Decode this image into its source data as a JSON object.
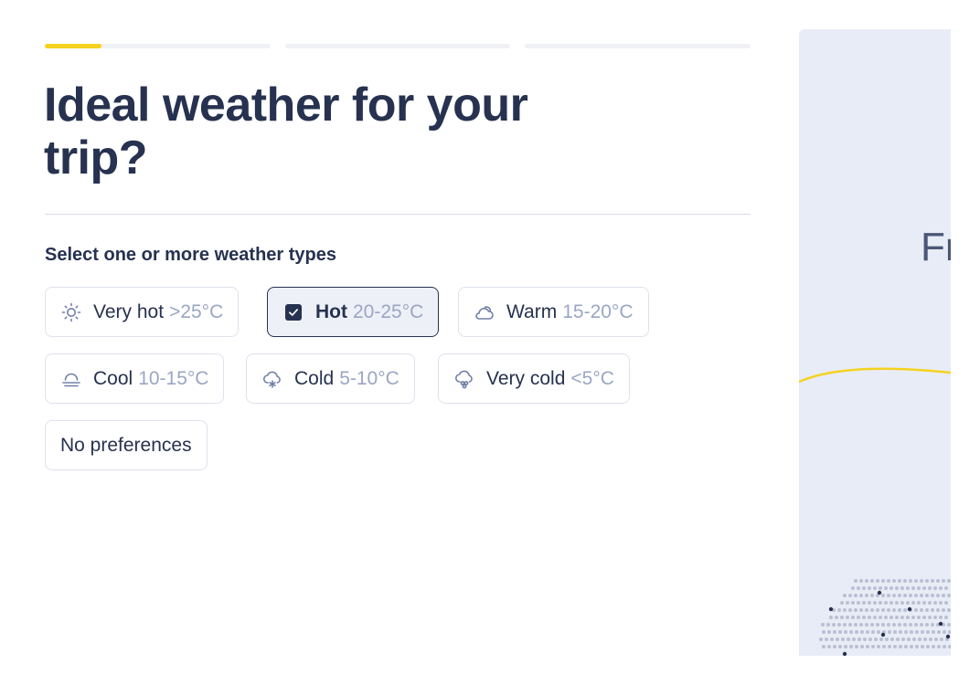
{
  "progress": {
    "steps": 3,
    "current_step": 1,
    "current_step_fill_fraction": 0.25,
    "accent": "#f5d21f",
    "track": "#f0f1f6"
  },
  "title": "Ideal weather for your trip?",
  "subtitle": "Select one or more weather types",
  "options": [
    {
      "id": "very-hot",
      "icon": "sun-icon",
      "label": "Very hot",
      "range": ">25°C",
      "selected": false
    },
    {
      "id": "hot",
      "icon": "checkbox-checked-icon",
      "label": "Hot",
      "range": "20-25°C",
      "selected": true
    },
    {
      "id": "warm",
      "icon": "sun-cloud-icon",
      "label": "Warm",
      "range": "15-20°C",
      "selected": false
    },
    {
      "id": "cool",
      "icon": "fog-icon",
      "label": "Cool",
      "range": "10-15°C",
      "selected": false
    },
    {
      "id": "cold",
      "icon": "cloud-snow-icon",
      "label": "Cold",
      "range": "5-10°C",
      "selected": false
    },
    {
      "id": "very-cold",
      "icon": "cloud-heavy-snow-icon",
      "label": "Very cold",
      "range": "<5°C",
      "selected": false
    },
    {
      "id": "no-preferences",
      "icon": "",
      "label": "No preferences",
      "range": "",
      "selected": false
    }
  ],
  "side_panel": {
    "text": "Fr",
    "background": "#e8ecf6"
  },
  "colors": {
    "text_dark": "#26324f",
    "muted": "#9aa6c2",
    "icon": "#7180a8",
    "border": "#dfe2ec"
  }
}
